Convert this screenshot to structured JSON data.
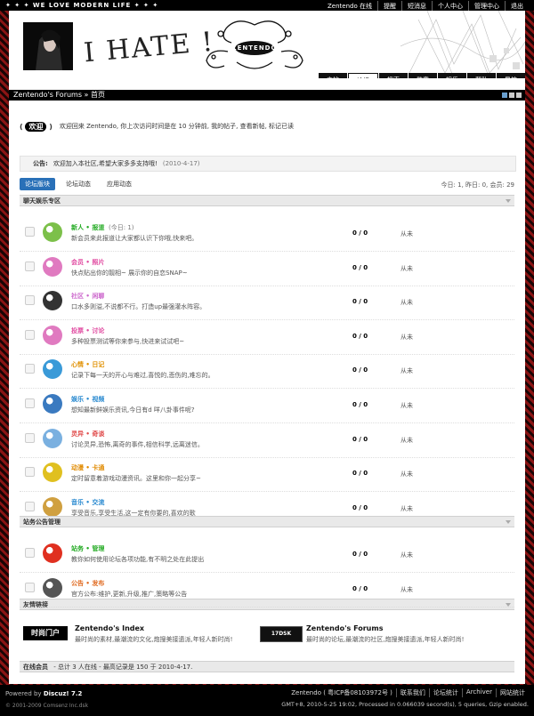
{
  "topbar": {
    "slogan": "✦ ✦ ✦ WE LOVE MODERN LIFE ✦ ✦ ✦",
    "user": "Zentendo 在线",
    "links": [
      "提醒",
      "短消息",
      "个人中心",
      "管理中心",
      "退出"
    ]
  },
  "banner": {
    "headline": "I HATE !",
    "logo_text": "ZENTENDO"
  },
  "nav": [
    "主站",
    "论坛",
    "搜索",
    "勋章",
    "娱乐",
    "帮助",
    "导航"
  ],
  "nav_active_index": 1,
  "breadcrumb": "Zentendo's Forums » 首页",
  "welcome": {
    "badge": "欢迎",
    "text": "欢迎回来 Zentendo, 你上次访问时间是在 10 分钟前, 我的帖子, 查看新帖, 标记已读"
  },
  "notice": {
    "label": "公告:",
    "text": "欢迎加入本社区,希望大家多多支持哦!",
    "date": "(2010-4-17)"
  },
  "tabs": [
    "论坛版块",
    "论坛动态",
    "应用动态"
  ],
  "stats": "今日: 1, 昨日: 0, 会员: 29",
  "sections": [
    {
      "title": "聊天娱乐专区",
      "forums": [
        {
          "name": "新人 • 报道",
          "today": "(今日: 1)",
          "desc": "新会员来此报道让大家都认识下你哦,快来吧。",
          "count": "0 / 0",
          "last": "从未",
          "color": "#22aa22",
          "icon": "#7cc04a"
        },
        {
          "name": "会员 • 照片",
          "today": "",
          "desc": "快点贴出你的靓相~ 展示你的自恋SNAP~",
          "count": "0 / 0",
          "last": "从未",
          "color": "#e04aa0",
          "icon": "#e07ac0"
        },
        {
          "name": "社区 • 闲聊",
          "today": "",
          "desc": "口水多则溢,不说都不行。打造up最强灌水阵容。",
          "count": "0 / 0",
          "last": "从未",
          "color": "#cc66cc",
          "icon": "#333333"
        },
        {
          "name": "投票 • 讨论",
          "today": "",
          "desc": "多种投票测试等你来参与,快进来试试吧~",
          "count": "0 / 0",
          "last": "从未",
          "color": "#e04aa0",
          "icon": "#e07ac0"
        },
        {
          "name": "心情 • 日记",
          "today": "",
          "desc": "记录下每一天的开心与难过,喜悦的,悲伤的,难忘的。",
          "count": "0 / 0",
          "last": "从未",
          "color": "#e09000",
          "icon": "#3a9ad8"
        },
        {
          "name": "娱乐 • 视频",
          "today": "",
          "desc": "想知最新鲜娱乐资讯,今日有d 咩八卦事件呢?",
          "count": "0 / 0",
          "last": "从未",
          "color": "#2a8ad0",
          "icon": "#3a7ac0"
        },
        {
          "name": "灵异 • 奇谈",
          "today": "",
          "desc": "讨论灵异,恐怖,离奇的事件,相信科学,远离迷信。",
          "count": "0 / 0",
          "last": "从未",
          "color": "#e04a4a",
          "icon": "#7ab0e0"
        },
        {
          "name": "动漫 • 卡通",
          "today": "",
          "desc": "定时留意着游戏动漫资讯。这里和你一起分享~",
          "count": "0 / 0",
          "last": "从未",
          "color": "#e08a00",
          "icon": "#e0c020"
        },
        {
          "name": "音乐 • 交流",
          "today": "",
          "desc": "享受音乐,享受生活,这一定有你要的,喜欢的歌",
          "count": "0 / 0",
          "last": "从未",
          "color": "#2a8ad0",
          "icon": "#d0a040"
        }
      ]
    },
    {
      "title": "站务公告管理",
      "forums": [
        {
          "name": "站务 • 管理",
          "today": "",
          "desc": "教你如何使用论坛各项功能,有不明之处在此提出",
          "count": "0 / 0",
          "last": "从未",
          "color": "#22aa22",
          "icon": "#e03020"
        },
        {
          "name": "公告 • 发布",
          "today": "",
          "desc": "官方公布:维护,更新,升级,推广,策略等公告",
          "count": "0 / 0",
          "last": "从未",
          "color": "#e06a20",
          "icon": "#555555"
        }
      ]
    }
  ],
  "friends": {
    "title": "友情链接",
    "items": [
      {
        "logo": "时尚门户",
        "name": "Zentendo's Index",
        "desc": "最时尚的素材,最潮流的文化,炮搜美接遗派,年轻人新时尚!"
      },
      {
        "logo": "17DSK",
        "name": "Zentendo's Forums",
        "desc": "最时尚的论坛,最潮流的社区,炮搜美接遗派,年轻人新时尚!"
      }
    ]
  },
  "online": {
    "label": "在线会员",
    "text": "- 总计 3 人在线 - 最高记录是 150 于 2010-4-17."
  },
  "footer": {
    "powered_prefix": "Powered by",
    "powered_name": "Discuz! 7.2",
    "copyright": "© 2001-2009 Comsenz Inc.dsk",
    "links": [
      "Zentendo ( 粤ICP备08103972号 )",
      "联系我们",
      "论坛统计",
      "Archiver",
      "网站统计"
    ],
    "gmt": "GMT+8, 2010-5-25 19:02, Processed in 0.066039 second(s), 5 queries, Gzip enabled."
  }
}
